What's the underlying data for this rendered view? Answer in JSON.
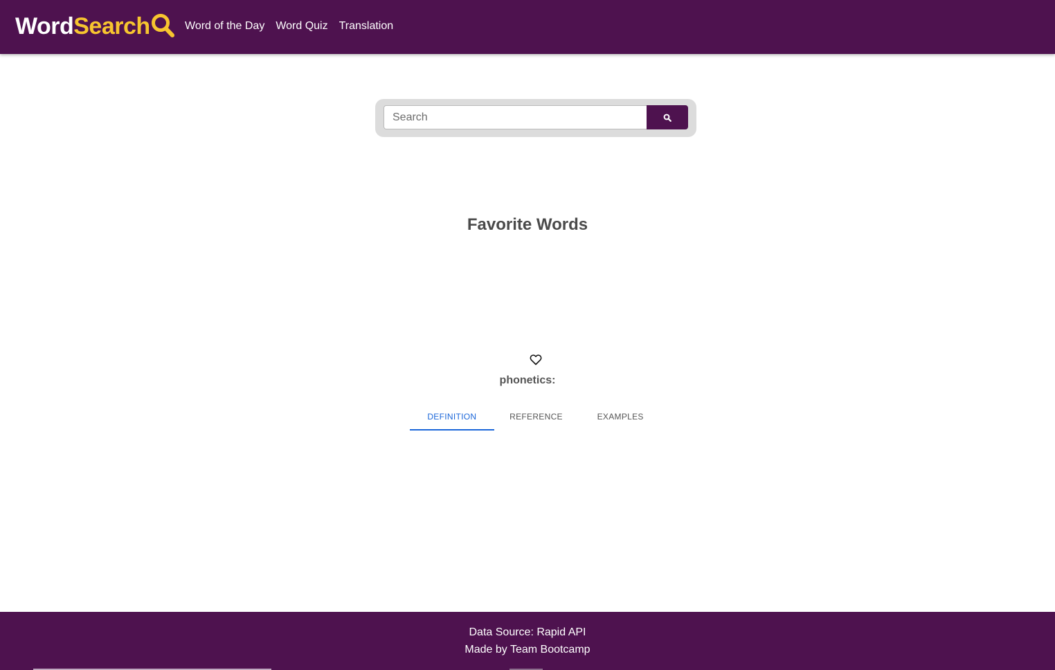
{
  "brand": {
    "word": "Word",
    "search": "Search",
    "icon": "magnifier-icon",
    "word_color": "#ffffff",
    "search_color": "#f7c52f"
  },
  "nav": {
    "items": [
      {
        "label": "Word of the Day"
      },
      {
        "label": "Word Quiz"
      },
      {
        "label": "Translation"
      }
    ]
  },
  "search": {
    "placeholder": "Search",
    "value": "",
    "button_icon": "search-icon"
  },
  "favorites": {
    "title": "Favorite Words"
  },
  "word_card": {
    "favorite_icon": "heart-outline-icon",
    "phonetics_label": "phonetics:"
  },
  "tabs": [
    {
      "label": "DEFINITION",
      "active": true
    },
    {
      "label": "REFERENCE",
      "active": false
    },
    {
      "label": "EXAMPLES",
      "active": false
    }
  ],
  "footer": {
    "line1": "Data Source: Rapid API",
    "line2": "Made by Team Bootcamp"
  },
  "colors": {
    "primary": "#4e124f",
    "accent": "#f7c52f",
    "active_tab": "#1a66d9"
  }
}
